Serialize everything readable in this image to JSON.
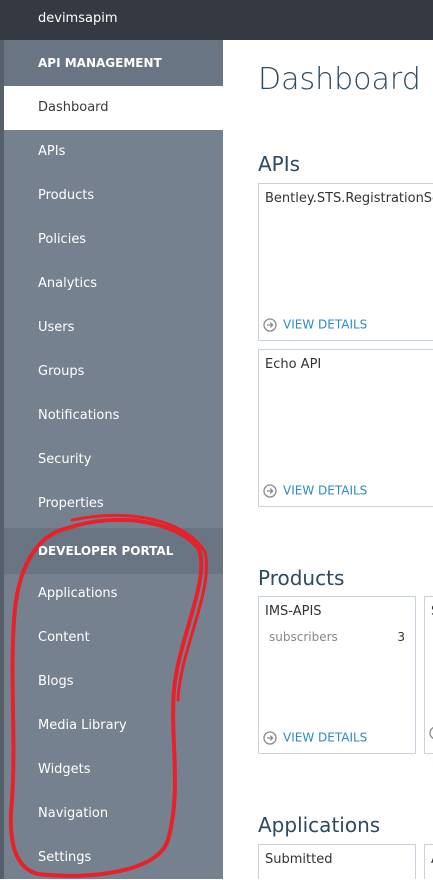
{
  "topbar": {
    "service_name": "devimsapim"
  },
  "sidebar": {
    "api_management_header": "API MANAGEMENT",
    "api_items": [
      {
        "label": "Dashboard",
        "active": true
      },
      {
        "label": "APIs"
      },
      {
        "label": "Products"
      },
      {
        "label": "Policies"
      },
      {
        "label": "Analytics"
      },
      {
        "label": "Users"
      },
      {
        "label": "Groups"
      },
      {
        "label": "Notifications"
      },
      {
        "label": "Security"
      },
      {
        "label": "Properties"
      }
    ],
    "developer_portal_header": "DEVELOPER PORTAL",
    "portal_items": [
      {
        "label": "Applications"
      },
      {
        "label": "Content"
      },
      {
        "label": "Blogs"
      },
      {
        "label": "Media Library"
      },
      {
        "label": "Widgets"
      },
      {
        "label": "Navigation"
      },
      {
        "label": "Settings"
      }
    ]
  },
  "main": {
    "title": "Dashboard",
    "apis": {
      "heading": "APIs",
      "tiles": [
        {
          "name": "Bentley.STS.RegistrationSe",
          "link": "VIEW DETAILS"
        },
        {
          "name": "Echo API",
          "link": "VIEW DETAILS"
        }
      ]
    },
    "products": {
      "heading": "Products",
      "tiles": [
        {
          "name": "IMS-APIS",
          "stat_label": "subscribers",
          "stat_value": "3",
          "link": "VIEW DETAILS"
        },
        {
          "name": "S"
        }
      ]
    },
    "applications": {
      "heading": "Applications",
      "tiles": [
        {
          "name": "Submitted"
        },
        {
          "name": "A"
        }
      ]
    }
  },
  "colors": {
    "topbar": "#353a42",
    "sidebar": "#76818f",
    "section_header": "#6a7583",
    "title": "#2e4a5e",
    "link": "#2b8ac6",
    "annotation": "#e8202a"
  }
}
